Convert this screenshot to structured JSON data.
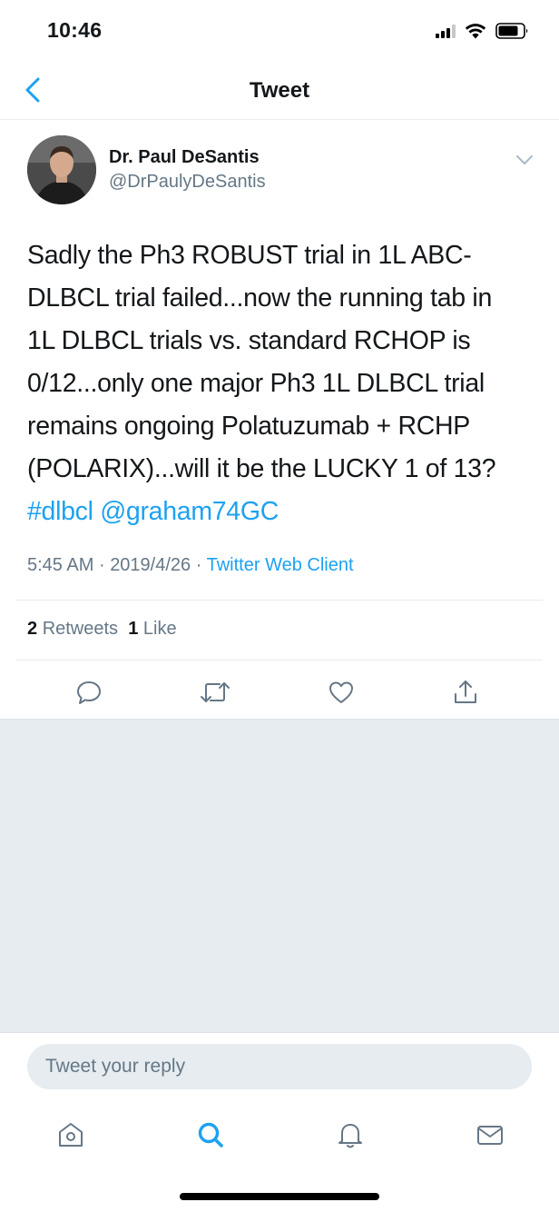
{
  "status_bar": {
    "time": "10:46"
  },
  "nav": {
    "title": "Tweet",
    "back_icon": "chevron-left-icon"
  },
  "tweet": {
    "author_name": "Dr. Paul DeSantis",
    "author_handle": "@DrPaulyDeSantis",
    "text_lines": [
      "Sadly the Ph3 ROBUST trial in 1L ABC-",
      "DLBCL trial failed...now the running tab in",
      "1L DLBCL trials vs. standard RCHOP is",
      "0/12...only one major Ph3 1L DLBCL trial",
      "remains ongoing Polatuzumab + RCHP",
      "(POLARIX)...will it be the LUCKY 1 of 13?"
    ],
    "hashtag": "#dlbcl",
    "mention": "@graham74GC",
    "time": "5:45 AM",
    "date": "2019/4/26",
    "separator": "·",
    "client": "Twitter Web Client",
    "retweet_count": "2",
    "retweet_label": "Retweets",
    "like_count": "1",
    "like_label": "Like"
  },
  "actions": [
    {
      "name": "reply",
      "icon": "reply-icon"
    },
    {
      "name": "retweet",
      "icon": "retweet-icon"
    },
    {
      "name": "like",
      "icon": "heart-icon"
    },
    {
      "name": "share",
      "icon": "share-icon"
    }
  ],
  "reply": {
    "placeholder": "Tweet your reply"
  },
  "tabs": [
    {
      "name": "home",
      "icon": "home-icon",
      "active": false
    },
    {
      "name": "search",
      "icon": "search-icon",
      "active": true
    },
    {
      "name": "notifications",
      "icon": "bell-icon",
      "active": false
    },
    {
      "name": "messages",
      "icon": "mail-icon",
      "active": false
    }
  ],
  "colors": {
    "accent": "#1da1f2",
    "text": "#14171a",
    "secondary": "#657786",
    "background_gray": "#e6ecf0",
    "icon_gray": "#657786"
  }
}
